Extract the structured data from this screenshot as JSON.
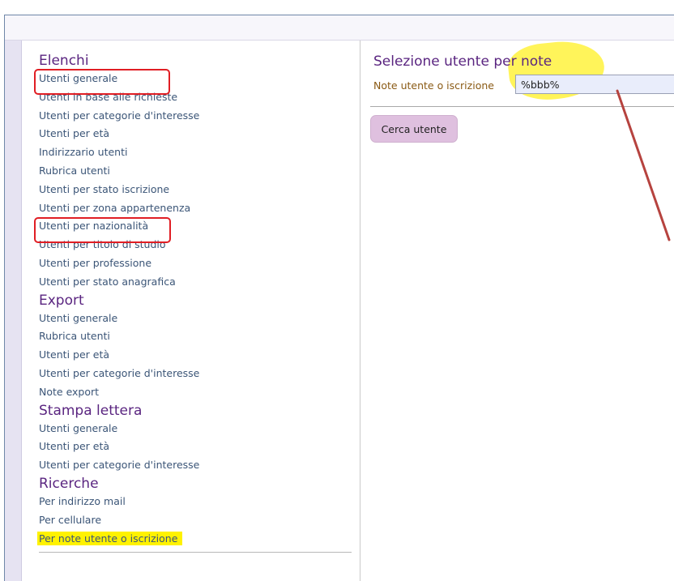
{
  "sidebar": {
    "sections": [
      {
        "title": "Elenchi",
        "items": [
          "Utenti generale",
          "Utenti in base alle richieste",
          "Utenti per categorie d'interesse",
          "Utenti per età",
          "Indirizzario utenti",
          "Rubrica utenti",
          "Utenti per stato iscrizione",
          "Utenti per zona appartenenza",
          "Utenti per nazionalità",
          "Utenti per titolo di studio",
          "Utenti per professione",
          "Utenti per stato anagrafica"
        ]
      },
      {
        "title": "Export",
        "items": [
          "Utenti generale",
          "Rubrica utenti",
          "Utenti per età",
          "Utenti per categorie d'interesse",
          "Note export"
        ]
      },
      {
        "title": "Stampa lettera",
        "items": [
          "Utenti generale",
          "Utenti per età",
          "Utenti per categorie d'interesse"
        ]
      },
      {
        "title": "Ricerche",
        "items": [
          "Per indirizzo mail",
          "Per cellulare",
          "Per note utente o iscrizione"
        ]
      }
    ]
  },
  "main": {
    "title": "Selezione utente per note",
    "field_label": "Note utente o iscrizione",
    "field_value": "%bbb%",
    "search_button": "Cerca utente"
  },
  "annotations": {
    "highlight_color": "#fff200",
    "box_color": "#e01e24",
    "arrow_color": "#b6433f"
  }
}
